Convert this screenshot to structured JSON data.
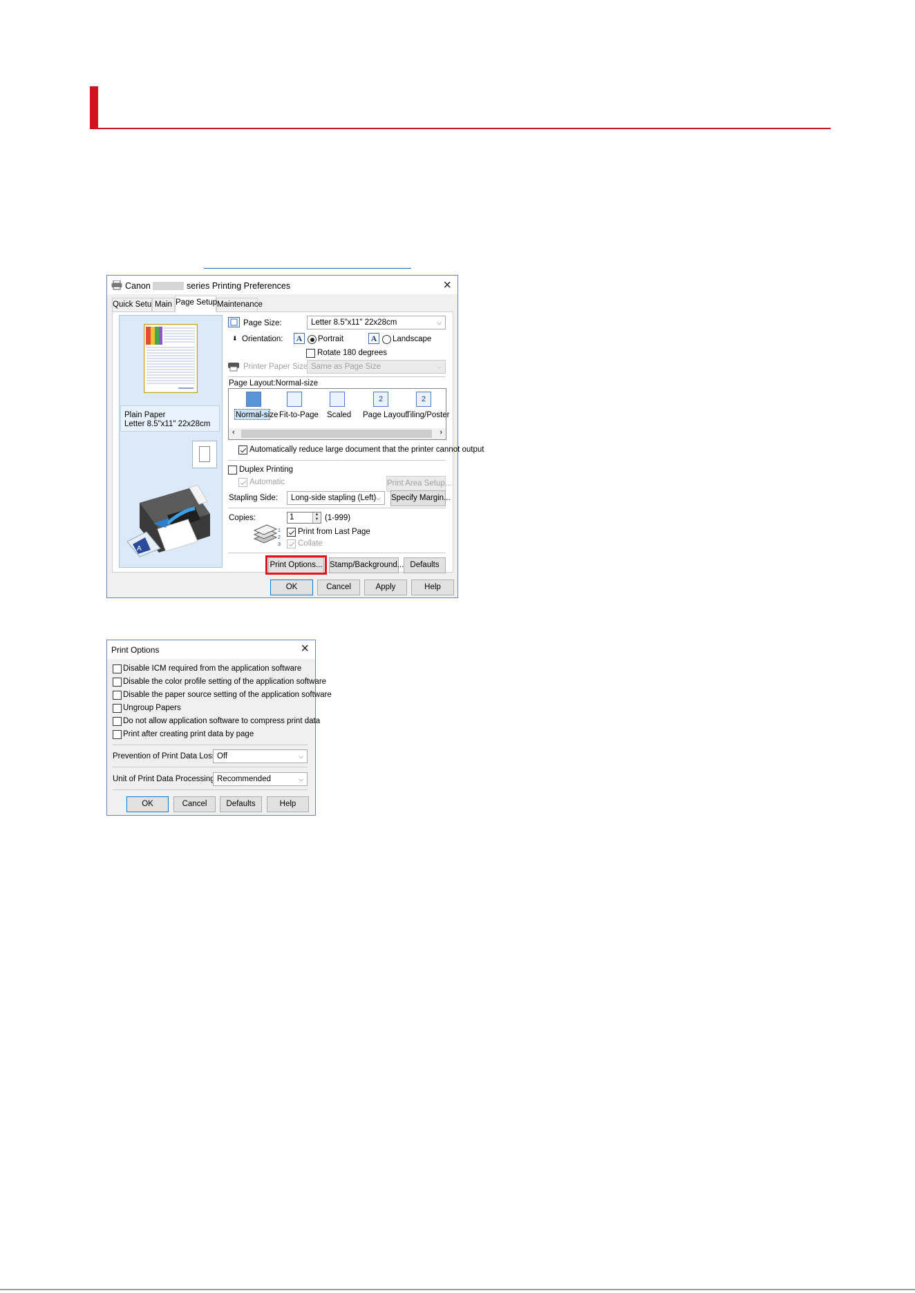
{
  "prefs": {
    "title_brand": "Canon",
    "title_suffix": "series Printing Preferences",
    "tabs": [
      "Quick Setup",
      "Main",
      "Page Setup",
      "Maintenance"
    ],
    "active_tab": "Page Setup",
    "preview_media": "Plain Paper",
    "preview_size": "Letter 8.5\"x11\" 22x28cm",
    "page_size_label": "Page Size:",
    "page_size_value": "Letter 8.5\"x11\" 22x28cm",
    "orientation_label": "Orientation:",
    "portrait": "Portrait",
    "landscape": "Landscape",
    "orientation_selected": "Portrait",
    "rotate_label": "Rotate 180 degrees",
    "rotate_checked": false,
    "printer_paper_size_label": "Printer Paper Size:",
    "printer_paper_size_value": "Same as Page Size",
    "page_layout_label": "Page Layout:Normal-size",
    "layouts": [
      "Normal-size",
      "Fit-to-Page",
      "Scaled",
      "Page Layout",
      "Tiling/Poster"
    ],
    "layout_selected": "Normal-size",
    "auto_reduce_label": "Automatically reduce large document that the printer cannot output",
    "auto_reduce_checked": true,
    "duplex_label": "Duplex Printing",
    "duplex_checked": false,
    "automatic_label": "Automatic",
    "print_area_setup": "Print Area Setup...",
    "stapling_side_label": "Stapling Side:",
    "stapling_side_value": "Long-side stapling (Left)",
    "specify_margin": "Specify Margin...",
    "copies_label": "Copies:",
    "copies_value": "1",
    "copies_range": "(1-999)",
    "print_from_last_label": "Print from Last Page",
    "print_from_last_checked": true,
    "collate_label": "Collate",
    "print_options": "Print Options...",
    "stamp_background": "Stamp/Background...",
    "defaults": "Defaults",
    "ok": "OK",
    "cancel": "Cancel",
    "apply": "Apply",
    "help": "Help"
  },
  "print_options": {
    "title": "Print Options",
    "checkboxes": [
      "Disable ICM required from the application software",
      "Disable the color profile setting of the application software",
      "Disable the paper source setting of the application software",
      "Ungroup Papers",
      "Do not allow application software to compress print data",
      "Print after creating print data by page"
    ],
    "prevention_label": "Prevention of Print Data Loss:",
    "prevention_value": "Off",
    "unit_label": "Unit of Print Data Processing:",
    "unit_value": "Recommended",
    "ok": "OK",
    "cancel": "Cancel",
    "defaults": "Defaults",
    "help": "Help"
  },
  "icons": {
    "printer": "printer-icon",
    "close": "close-icon",
    "orientation_a": "orientation-a-icon"
  }
}
